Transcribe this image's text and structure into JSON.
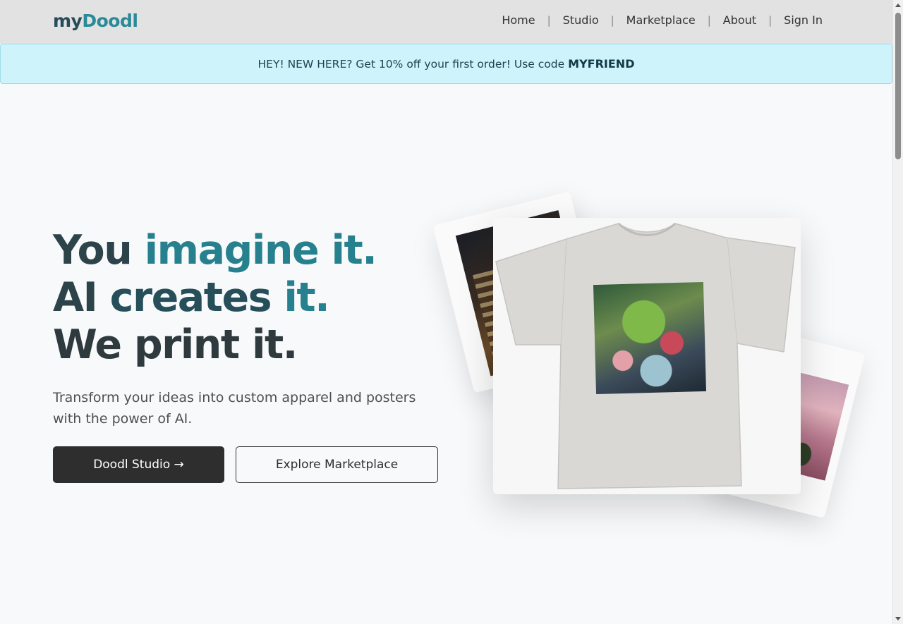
{
  "header": {
    "logo_part1": "my",
    "logo_part2": "Doodl",
    "nav": [
      {
        "label": "Home"
      },
      {
        "label": "Studio"
      },
      {
        "label": "Marketplace"
      },
      {
        "label": "About"
      },
      {
        "label": "Sign In"
      }
    ],
    "separator": "|"
  },
  "promo": {
    "text": "HEY! NEW HERE? Get 10% off your first order! Use code",
    "code": "MYFRIEND"
  },
  "hero": {
    "line1a": "You ",
    "line1b": "imagine it.",
    "line2a": "AI ",
    "line2b": "creates ",
    "line2c": "it.",
    "line3": "We print it.",
    "subtitle": "Transform your ideas into custom apparel and posters with the power of AI.",
    "primary_button": "Doodl Studio →",
    "secondary_button": "Explore Marketplace"
  },
  "colors": {
    "accent_teal": "#26808d",
    "dark_slate": "#2c4349",
    "promo_bg": "#cef3fb",
    "button_dark": "#2e2e2e"
  },
  "icons": {
    "arrow": "right-arrow-icon"
  }
}
